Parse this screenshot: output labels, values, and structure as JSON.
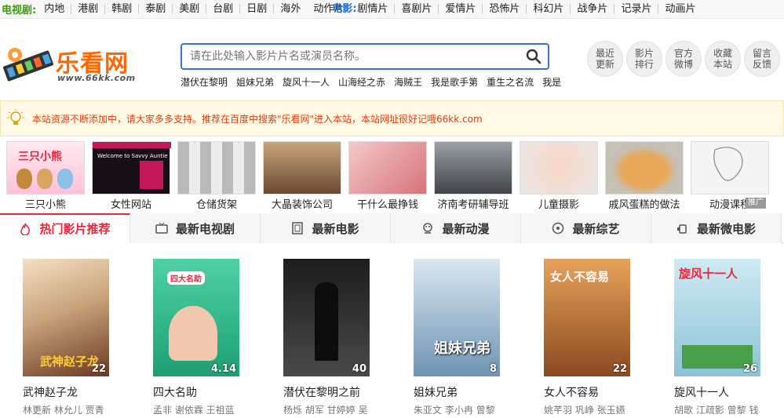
{
  "nav": {
    "tv_label": "电视剧:",
    "tv_items": [
      "内地",
      "港剧",
      "韩剧",
      "泰剧",
      "美剧",
      "台剧",
      "日剧",
      "海外"
    ],
    "movie_label": "电影:",
    "movie_items": [
      "动作片",
      "剧情片",
      "喜剧片",
      "爱情片",
      "恐怖片",
      "科幻片",
      "战争片",
      "记录片",
      "动画片"
    ]
  },
  "logo": {
    "title": "乐看网",
    "url": "www.66kk.com"
  },
  "search": {
    "placeholder": "请在此处输入影片片名或演员名称。",
    "hotwords": [
      "潜伏在黎明",
      "姐妹兄弟",
      "旋风十一人",
      "山海经之赤",
      "海贼王",
      "我是歌手第",
      "重生之名流",
      "我是"
    ]
  },
  "right_buttons": [
    "最近更新",
    "影片排行",
    "官方微博",
    "收藏本站",
    "留言反馈"
  ],
  "notice": {
    "text": "本站资源不断添加中，请大家多多支持。推荐在百度中搜索\"乐看网\"进入本站，本站网址很好记哦66kk.com"
  },
  "ads": {
    "items": [
      "三只小熊",
      "女性网站",
      "仓储货架",
      "大晶装饰公司",
      "干什么最挣钱",
      "济南考研辅导班",
      "儿童摄影",
      "戚风蛋糕的做法",
      "动漫课程"
    ],
    "tag": "推广",
    "thumb_text": [
      "三只小熊",
      "Welcome to Savvy Auntie"
    ]
  },
  "tabs": [
    "热门影片推荐",
    "最新电视剧",
    "最新电影",
    "最新动漫",
    "最新综艺",
    "最新微电影"
  ],
  "movies": [
    {
      "title": "武神赵子龙",
      "cast": "林更新 林允儿 贾青",
      "badge": "22",
      "color": "#c9a37a"
    },
    {
      "title": "四大名助",
      "cast": "孟非 谢依霖 王祖蓝",
      "badge": "4.14",
      "color": "#3cb88a"
    },
    {
      "title": "潜伏在黎明之前",
      "cast": "杨烁 胡军 甘婷婷 吴",
      "badge": "40",
      "color": "#2e2e2e"
    },
    {
      "title": "姐妹兄弟",
      "cast": "朱亚文 李小冉 曾黎",
      "badge": "8",
      "color": "#7aa3c4"
    },
    {
      "title": "女人不容易",
      "cast": "姚芊羽 巩峥 张玉嬿",
      "badge": "22",
      "color": "#d88a3c"
    },
    {
      "title": "旋风十一人",
      "cast": "胡歌 江疏影 曾黎 钱",
      "badge": "26",
      "color": "#9fd0e0"
    }
  ],
  "poster_text": [
    "武神赵子龙",
    "四大名助",
    "姐妹兄弟",
    "女人不容易",
    "旋风十一人"
  ]
}
